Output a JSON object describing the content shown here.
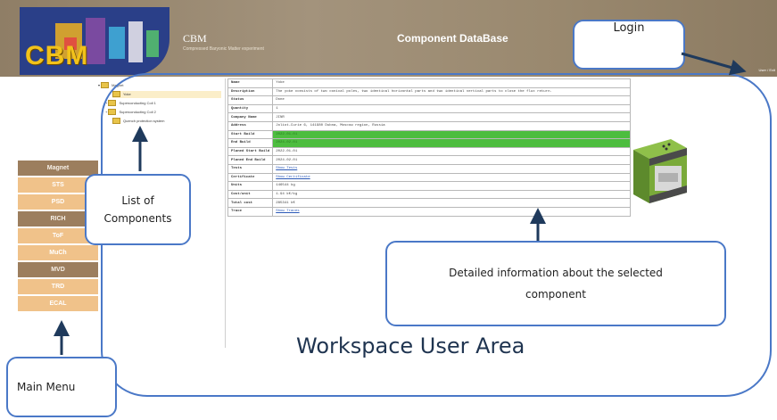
{
  "header": {
    "logo_text": "CBM",
    "title": "CBM",
    "subtitle": "Compressed Baryonic Matter experiment",
    "db_title": "Component DataBase",
    "user_links": "User / Exit"
  },
  "menu": {
    "items": [
      {
        "label": "Magnet",
        "style": "dark"
      },
      {
        "label": "STS",
        "style": "light"
      },
      {
        "label": "PSD",
        "style": "light"
      },
      {
        "label": "RICH",
        "style": "dark"
      },
      {
        "label": "ToF",
        "style": "light"
      },
      {
        "label": "MuCh",
        "style": "light"
      },
      {
        "label": "MVD",
        "style": "dark"
      },
      {
        "label": "TRD",
        "style": "light"
      },
      {
        "label": "ECAL",
        "style": "light"
      }
    ]
  },
  "tree": {
    "root": "Magnet",
    "items": [
      {
        "label": "Yoke",
        "selected": true
      },
      {
        "label": "Superconducting Coil 1"
      },
      {
        "label": "Superconducting Coil 2"
      },
      {
        "label": "Quench protection system"
      }
    ]
  },
  "details": {
    "rows": [
      {
        "key": "Name",
        "value": "Yoke"
      },
      {
        "key": "Description",
        "value": "The yoke consists of two conical poles, two identical horizontal parts and two identical vertical parts to close the flux return."
      },
      {
        "key": "Status",
        "value": "Done"
      },
      {
        "key": "Quantity",
        "value": "1"
      },
      {
        "key": "Company Name",
        "value": "JINR"
      },
      {
        "key": "Address",
        "value": "Joliot-Curie 6, 141980 Dubna, Moscow region, Russia"
      },
      {
        "key": "Start Build",
        "value": "2022-01-01",
        "style": "green"
      },
      {
        "key": "End Build",
        "value": "2024-02-01",
        "style": "green"
      },
      {
        "key": "Planed Start Build",
        "value": "2022-01-01"
      },
      {
        "key": "Planed End Build",
        "value": "2024-02-01"
      },
      {
        "key": "Tests",
        "value": "Show Tests",
        "style": "link"
      },
      {
        "key": "Certificate",
        "value": "Show Certificate",
        "style": "link"
      },
      {
        "key": "Units",
        "value": "146544 kg"
      },
      {
        "key": "Cost/unit",
        "value": "1.94 k€/kg"
      },
      {
        "key": "Total cost",
        "value": "285341 k€"
      },
      {
        "key": "Trace",
        "value": "Show Traces",
        "style": "link"
      }
    ]
  },
  "annotations": {
    "login": "Login",
    "list_of_components": [
      "List of",
      "Components"
    ],
    "detailed_info": [
      "Detailed information about the selected",
      "component"
    ],
    "main_menu": "Main Menu",
    "workspace": "Workspace User Area"
  },
  "colors": {
    "header_bg": "#9a896f",
    "logo_bg": "#2a3f88",
    "logo_text": "#f2c21a",
    "menu_dark": "#9c7e5e",
    "menu_light": "#f0c28a",
    "green_row": "#4dbd3f",
    "callout_border": "#4a78c7",
    "arrow": "#1f3a5c"
  }
}
